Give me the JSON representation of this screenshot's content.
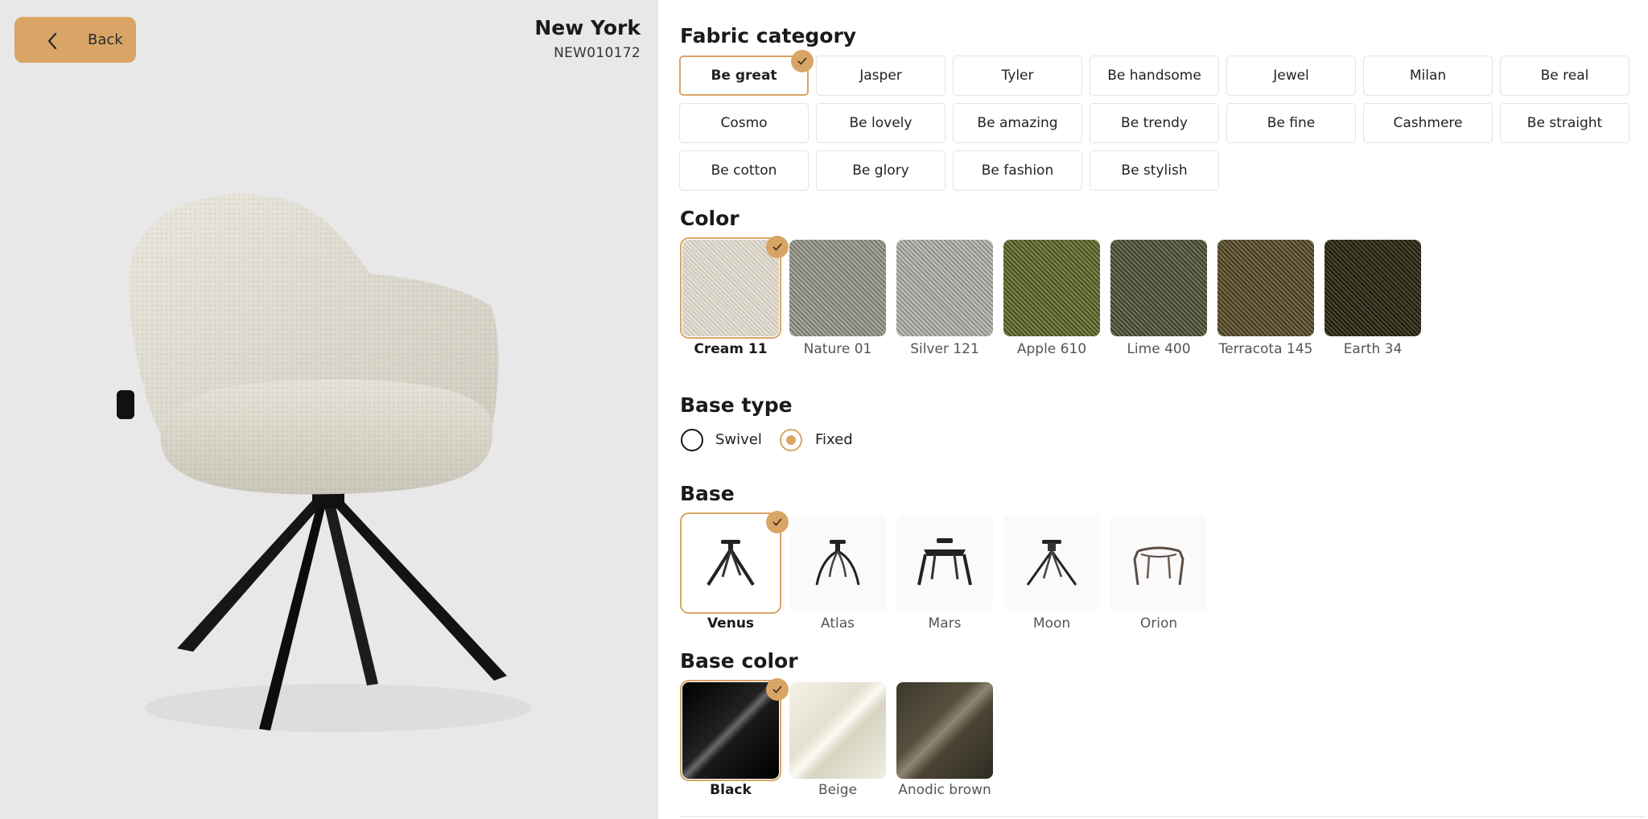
{
  "header": {
    "back_label": "Back",
    "title": "New York",
    "code": "NEW010172"
  },
  "accent_color": "#d9a566",
  "fabric_category": {
    "title": "Fabric category",
    "selected": "Be great",
    "options": [
      "Be great",
      "Jasper",
      "Tyler",
      "Be handsome",
      "Jewel",
      "Milan",
      "Be real",
      "Cosmo",
      "Be lovely",
      "Be amazing",
      "Be trendy",
      "Be fine",
      "Cashmere",
      "Be straight",
      "Be cotton",
      "Be glory",
      "Be fashion",
      "Be stylish"
    ]
  },
  "color": {
    "title": "Color",
    "selected": "Cream 11",
    "options": [
      {
        "label": "Cream 11",
        "hex": "#d8d2c4"
      },
      {
        "label": "Nature 01",
        "hex": "#8e8d80"
      },
      {
        "label": "Silver 121",
        "hex": "#a7a6a0"
      },
      {
        "label": "Apple 610",
        "hex": "#5d6a34"
      },
      {
        "label": "Lime 400",
        "hex": "#55593f"
      },
      {
        "label": "Terracota 145",
        "hex": "#5a5134"
      },
      {
        "label": "Earth 34",
        "hex": "#2d2c1d"
      }
    ]
  },
  "base_type": {
    "title": "Base type",
    "selected": "Fixed",
    "options": [
      "Swivel",
      "Fixed"
    ]
  },
  "base": {
    "title": "Base",
    "selected": "Venus",
    "options": [
      "Venus",
      "Atlas",
      "Mars",
      "Moon",
      "Orion"
    ]
  },
  "base_color": {
    "title": "Base color",
    "selected": "Black",
    "options": [
      {
        "label": "Black",
        "hex": "#111111"
      },
      {
        "label": "Beige",
        "hex": "#e4e0cf"
      },
      {
        "label": "Anodic brown",
        "hex": "#57503f"
      }
    ]
  }
}
